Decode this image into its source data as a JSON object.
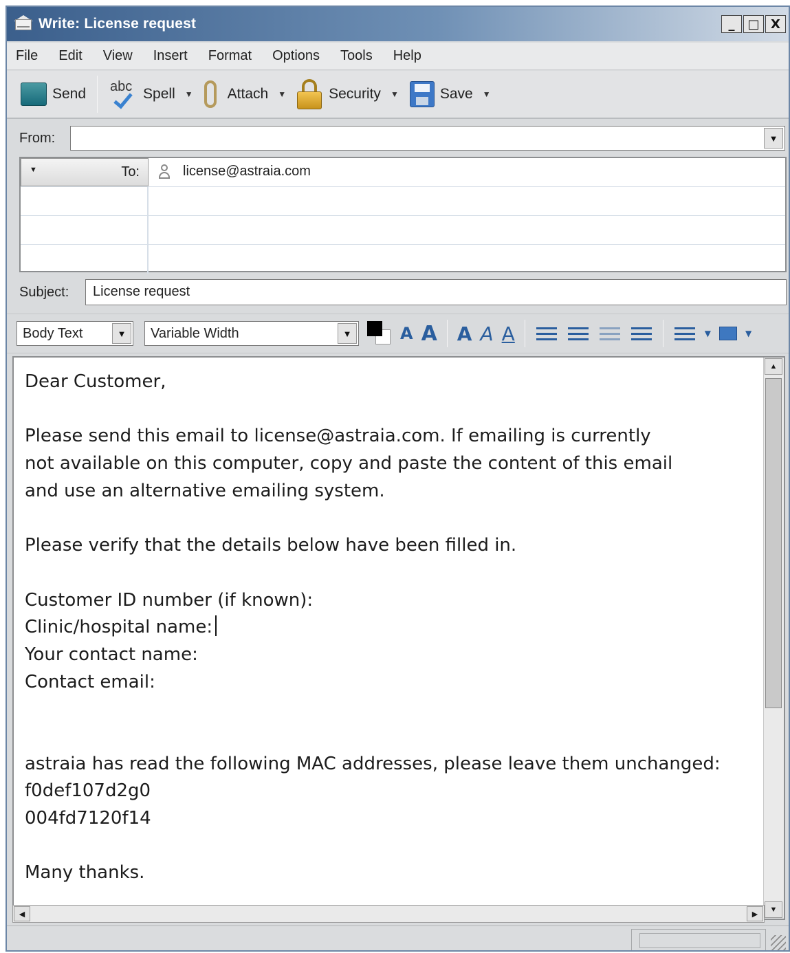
{
  "window": {
    "title": "Write: License request",
    "controls": {
      "minimize": "_",
      "maximize": "□",
      "close": "X"
    }
  },
  "menu": [
    "File",
    "Edit",
    "View",
    "Insert",
    "Format",
    "Options",
    "Tools",
    "Help"
  ],
  "toolbar": {
    "send": "Send",
    "spell": "Spell",
    "spell_icon_text": "abc",
    "attach": "Attach",
    "security": "Security",
    "save": "Save"
  },
  "header": {
    "from_label": "From:",
    "from_value": "",
    "to_label": "To:",
    "to_address": "license@astraia.com",
    "subject_label": "Subject:",
    "subject_value": "License request"
  },
  "format": {
    "paragraph_style": "Body Text",
    "font_face": "Variable Width",
    "smaller_text_glyph": "A",
    "larger_text_glyph": "A",
    "bold_glyph": "A",
    "italic_glyph": "A",
    "underline_glyph": "A"
  },
  "body": {
    "lines": [
      "Dear Customer,",
      "",
      "Please send this email to license@astraia.com. If emailing is currently",
      "not available on this computer, copy and paste the content of this email",
      "and use an alternative emailing system.",
      "",
      "Please verify that the details below have been filled in.",
      "",
      "Customer ID number (if known):",
      "Clinic/hospital name:",
      "Your contact name:",
      "Contact email:",
      "",
      "",
      "astraia has read the following MAC addresses, please leave them unchanged:",
      "f0def107d2g0",
      "004fd7120f14",
      "",
      "Many thanks."
    ]
  }
}
